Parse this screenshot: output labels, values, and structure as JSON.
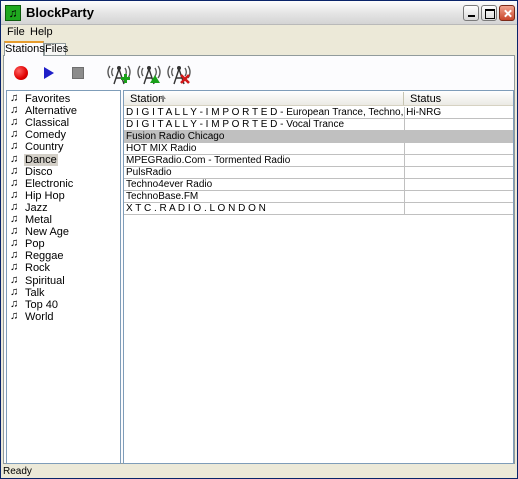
{
  "window": {
    "title": "BlockParty",
    "icon": "music-note-app-icon"
  },
  "menu": {
    "file": "File",
    "help": "Help"
  },
  "tabs": {
    "stations": "Stations",
    "files": "Files",
    "active": "Stations"
  },
  "toolbar": {
    "record": "record-icon",
    "play": "play-icon",
    "stop": "stop-icon",
    "add_station": "radio-tower-add-icon",
    "update_station": "radio-tower-up-icon",
    "delete_station": "radio-tower-delete-icon"
  },
  "genres": [
    "Favorites",
    "Alternative",
    "Classical",
    "Comedy",
    "Country",
    "Dance",
    "Disco",
    "Electronic",
    "Hip Hop",
    "Jazz",
    "Metal",
    "New Age",
    "Pop",
    "Reggae",
    "Rock",
    "Spiritual",
    "Talk",
    "Top 40",
    "World"
  ],
  "selected_genre": "Dance",
  "table": {
    "columns": {
      "station": "Station",
      "status": "Status"
    },
    "rows": [
      {
        "station": "D I G I T A L L Y - I M P O R T E D - European Trance, Techno, Hi-NRG",
        "status": ""
      },
      {
        "station": "D I G I T A L L Y - I M P O R T E D - Vocal Trance",
        "status": ""
      },
      {
        "station": "Fusion Radio Chicago",
        "status": ""
      },
      {
        "station": "HOT MIX Radio",
        "status": ""
      },
      {
        "station": "MPEGRadio.Com - Tormented Radio",
        "status": ""
      },
      {
        "station": "PulsRadio",
        "status": ""
      },
      {
        "station": "Techno4ever Radio",
        "status": ""
      },
      {
        "station": "TechnoBase.FM",
        "status": ""
      },
      {
        "station": "X T C . R A D I O . L O N D O N",
        "status": ""
      }
    ],
    "selected_row": "Fusion Radio Chicago"
  },
  "status": "Ready",
  "colors": {
    "selection": "#c0c0c0",
    "accent": "#e69c2d"
  }
}
